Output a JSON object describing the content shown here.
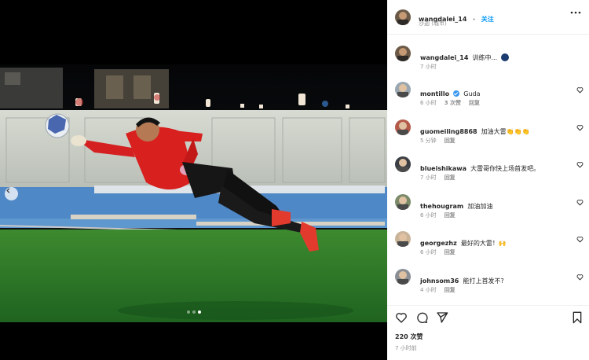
{
  "post": {
    "author": "wangdalei_14",
    "separator": "•",
    "follow_label": "关注",
    "location": "沙迦 (城市)",
    "caption_user": "wangdalei_14",
    "caption_text": "训练中...",
    "caption_time": "7 小时",
    "likes": "220 次赞",
    "date": "7 小时前"
  },
  "comments": [
    {
      "user": "montillo",
      "text": "Guda",
      "time": "6 小时",
      "likes": "3 次赞",
      "reply": "回复",
      "verified": true
    },
    {
      "user": "guomeiling8868",
      "text": "加油大雷👏👏👏",
      "time": "5 分钟",
      "likes": "",
      "reply": "回复",
      "verified": false
    },
    {
      "user": "blueishikawa",
      "text": "大雷哥你快上场首发吧。",
      "time": "7 小时",
      "likes": "",
      "reply": "回复",
      "verified": false
    },
    {
      "user": "thehougram",
      "text": "加油加油",
      "time": "6 小时",
      "likes": "",
      "reply": "回复",
      "verified": false
    },
    {
      "user": "georgezhz",
      "text": "最好的大雷！🙌",
      "time": "6 小时",
      "likes": "",
      "reply": "回复",
      "verified": false
    },
    {
      "user": "johnsom36",
      "text": "能打上首发不?",
      "time": "4 小时",
      "likes": "",
      "reply": "回复",
      "verified": false
    }
  ],
  "icons": {
    "more": "more-icon",
    "heart": "heart-icon",
    "comment": "comment-icon",
    "share": "share-icon",
    "save": "bookmark-icon",
    "prev": "chevron-left-icon"
  },
  "colors": {
    "accent": "#0095f6",
    "muted": "#8e8e8e",
    "pitch": "#2f7f2c",
    "track": "#4a86c8",
    "jersey": "#d81e1e"
  }
}
